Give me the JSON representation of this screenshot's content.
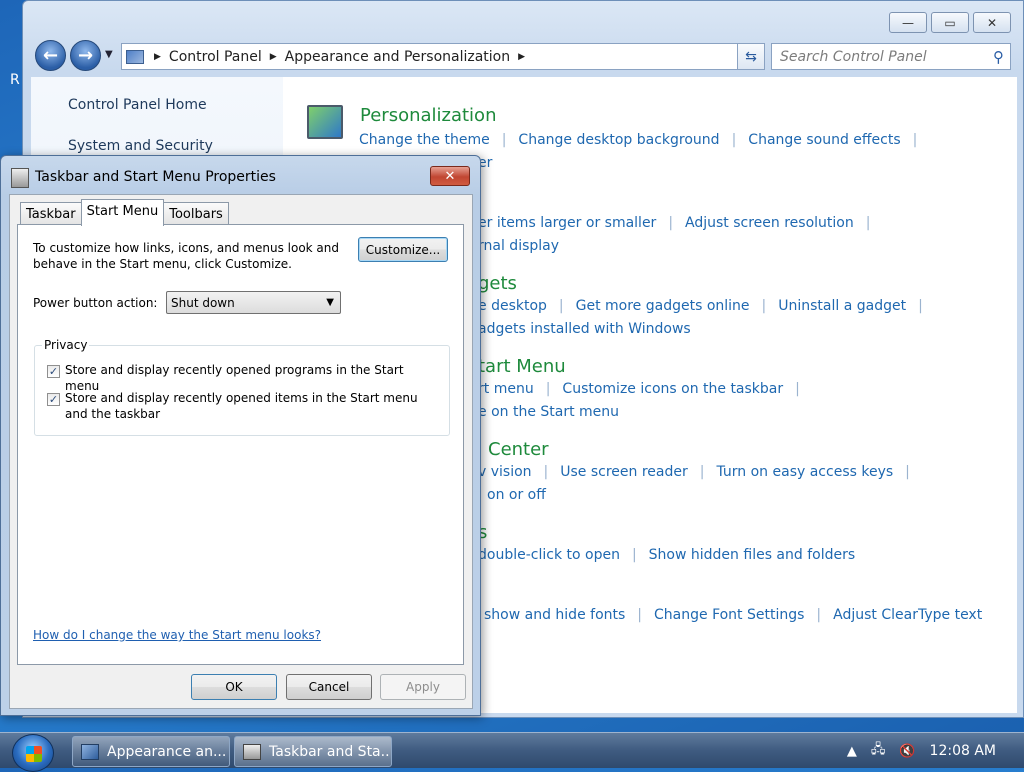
{
  "desktop": {
    "label": "R"
  },
  "explorer": {
    "controls": {
      "minimize": "—",
      "maximize": "▭",
      "close": "✕"
    },
    "breadcrumb": [
      "Control Panel",
      "Appearance and Personalization"
    ],
    "search_placeholder": "Search Control Panel",
    "left_links": [
      "Control Panel Home",
      "System and Security"
    ],
    "categories": [
      {
        "title": "Personalization",
        "links": [
          "Change the theme",
          "Change desktop background",
          "Change sound effects"
        ],
        "links2": [
          "er"
        ]
      },
      {
        "title": "",
        "links": [
          "er items larger or smaller",
          "Adjust screen resolution"
        ],
        "links2": [
          "rnal display"
        ]
      },
      {
        "title": "gets",
        "links": [
          "e desktop",
          "Get more gadgets online",
          "Uninstall a gadget"
        ],
        "links2": [
          "adgets installed with Windows"
        ]
      },
      {
        "title": "tart Menu",
        "links": [
          "rt menu",
          "Customize icons on the taskbar"
        ],
        "links2": [
          "e on the Start menu"
        ]
      },
      {
        "title": "Center",
        "links": [
          "v vision",
          "Use screen reader",
          "Turn on easy access keys"
        ],
        "links2": [
          "on or off"
        ]
      },
      {
        "title": "s",
        "links": [
          "double-click to open",
          "Show hidden files and folders"
        ],
        "links2": []
      },
      {
        "title": "",
        "links": [
          "show and hide fonts",
          "Change Font Settings",
          "Adjust ClearType text"
        ],
        "links2": []
      }
    ]
  },
  "dialog": {
    "title": "Taskbar and Start Menu Properties",
    "close": "✕",
    "tabs": [
      "Taskbar",
      "Start Menu",
      "Toolbars"
    ],
    "active_tab": "Start Menu",
    "description": "To customize how links, icons, and menus look and behave in the Start menu, click Customize.",
    "customize_label": "Customize...",
    "power_label": "Power button action:",
    "power_value": "Shut down",
    "privacy_legend": "Privacy",
    "privacy_options": [
      {
        "label": "Store and display recently opened programs in the Start menu",
        "checked": true
      },
      {
        "label": "Store and display recently opened items in the Start menu and the taskbar",
        "checked": true
      }
    ],
    "help_link": "How do I change the way the Start menu looks?",
    "ok_label": "OK",
    "cancel_label": "Cancel",
    "apply_label": "Apply"
  },
  "taskbar": {
    "buttons": [
      "Appearance an...",
      "Taskbar and Sta..."
    ],
    "tray_arrow": "▲",
    "clock": "12:08 AM"
  }
}
